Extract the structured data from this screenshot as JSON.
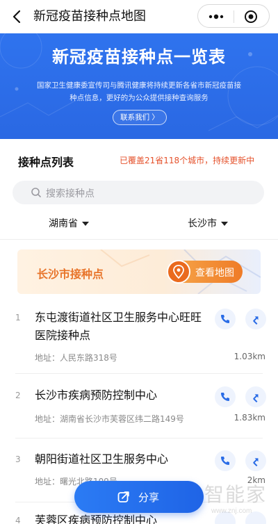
{
  "nav": {
    "title": "新冠疫苗接种点地图"
  },
  "banner": {
    "title": "新冠疫苗接种点一览表",
    "desc": "国家卫生健康委宣传司与腾讯健康将持续更新各省市新冠疫苗接种点信息，更好的为公众提供接种查询服务",
    "contact_label": "联系我们 〉"
  },
  "list": {
    "title": "接种点列表",
    "coverage": "已覆盖21省118个城市，持续更新中"
  },
  "search": {
    "placeholder": "搜索接种点"
  },
  "filters": {
    "province": "湖南省",
    "city": "长沙市"
  },
  "city_card": {
    "title": "长沙市接种点",
    "map_button": "查看地图"
  },
  "entries": [
    {
      "num": "1",
      "name": "东屯渡街道社区卫生服务中心旺旺医院接种点",
      "addr": "地址：人民东路318号",
      "dist": "1.03km"
    },
    {
      "num": "2",
      "name": "长沙市疾病预防控制中心",
      "addr": "地址：湖南省长沙市芙蓉区纬二路149号",
      "dist": "1.83km"
    },
    {
      "num": "3",
      "name": "朝阳街道社区卫生服务中心",
      "addr": "地址：曙光北路109号",
      "dist": "2km"
    },
    {
      "num": "4",
      "name": "芙蓉区疾病预防控制中心",
      "addr": "",
      "dist": ""
    }
  ],
  "share": {
    "label": "分享"
  },
  "watermark": {
    "big": "智能家",
    "small": "www.znj.com"
  },
  "colors": {
    "primary": "#2a6ce6",
    "accent_orange": "#ef7b27",
    "coverage_red": "#e5522c"
  }
}
